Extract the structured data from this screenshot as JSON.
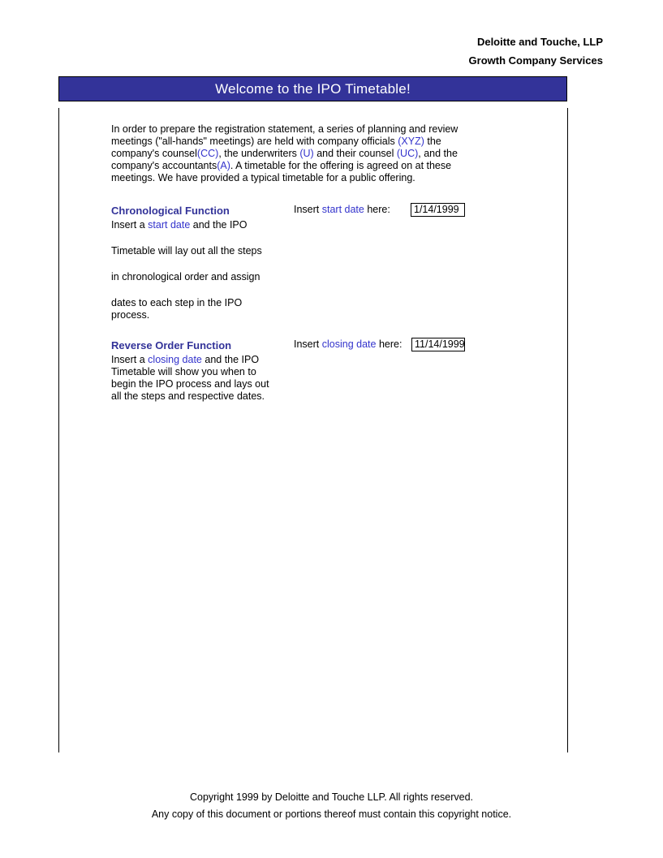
{
  "header": {
    "line1": "Deloitte and Touche, LLP",
    "line2": "Growth Company Services"
  },
  "banner": {
    "title": "Welcome to the IPO Timetable!",
    "background_color": "#333399",
    "text_color": "#FFFFFF"
  },
  "colors": {
    "accent_blue": "#3333CC",
    "heading_blue": "#333399",
    "rule_black": "#000000"
  },
  "intro": {
    "part1": "In order to prepare the registration statement, a series of planning and review meetings (\"all-hands\" meetings) are held with company officials ",
    "abbr_xyz": "(XYZ)",
    "part2": " the company's counsel",
    "abbr_cc": "(CC)",
    "part3": ", the underwriters ",
    "abbr_u": "(U)",
    "part4": " and their counsel ",
    "abbr_uc": "(UC)",
    "part5": ", and the company's accountants",
    "abbr_a": "(A)",
    "part6": ". A timetable for the offering is agreed on at these meetings. We have provided a typical timetable for a public offering."
  },
  "chronological": {
    "heading": "Chronological Function",
    "line1_pre": "Insert a ",
    "line1_link": "start date",
    "line1_post": " and the IPO",
    "line2": "Timetable will lay out all the steps",
    "line3": "in chronological order and assign",
    "line4a": "dates to each step in the IPO",
    "line4b": "process.",
    "date_label_pre": "Insert ",
    "date_label_link": "start date",
    "date_label_post": " here:",
    "date_value": "1/14/1999"
  },
  "reverse": {
    "heading": "Reverse Order Function",
    "line1_pre": "Insert a ",
    "line1_link": "closing date",
    "line1_post": " and the IPO",
    "line2": "Timetable will show you when to",
    "line3": "begin the IPO process and lays out",
    "line4": "all the steps and respective dates.",
    "date_label_pre": "Insert ",
    "date_label_link": "closing date",
    "date_label_post": " here:",
    "date_value": "11/14/1999"
  },
  "footer": {
    "line1": "Copyright 1999 by Deloitte and Touche LLP.  All rights reserved.",
    "line2": "Any copy of this document or portions thereof must contain this copyright notice."
  }
}
